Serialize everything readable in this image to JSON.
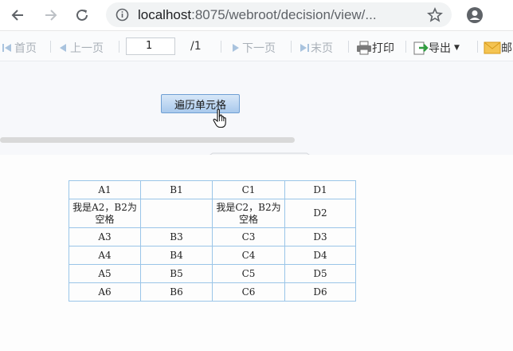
{
  "browser": {
    "url_host": "localhost",
    "url_rest": ":8075/webroot/decision/view/..."
  },
  "toolbar": {
    "first": "首页",
    "prev": "上一页",
    "page_value": "1",
    "total": "/1",
    "next": "下一页",
    "last": "末页",
    "print": "打印",
    "export": "导出",
    "mail": "邮"
  },
  "param": {
    "button_label": "遍历单元格"
  },
  "table": {
    "rows": [
      [
        "A1",
        "B1",
        "C1",
        "D1"
      ],
      [
        "我是A2，B2为空格",
        "",
        "我是C2，B2为空格",
        "D2"
      ],
      [
        "A3",
        "B3",
        "C3",
        "D3"
      ],
      [
        "A4",
        "B4",
        "C4",
        "D4"
      ],
      [
        "A5",
        "B5",
        "C5",
        "D5"
      ],
      [
        "A6",
        "B6",
        "C6",
        "D6"
      ]
    ]
  },
  "colors": {
    "accent": "#6f9fd3",
    "grid": "#9ac5e8"
  },
  "icons": [
    "back-icon",
    "forward-icon",
    "reload-icon",
    "info-icon",
    "star-icon",
    "account-icon",
    "print-icon",
    "export-icon",
    "mail-icon",
    "cursor-hand-icon"
  ]
}
